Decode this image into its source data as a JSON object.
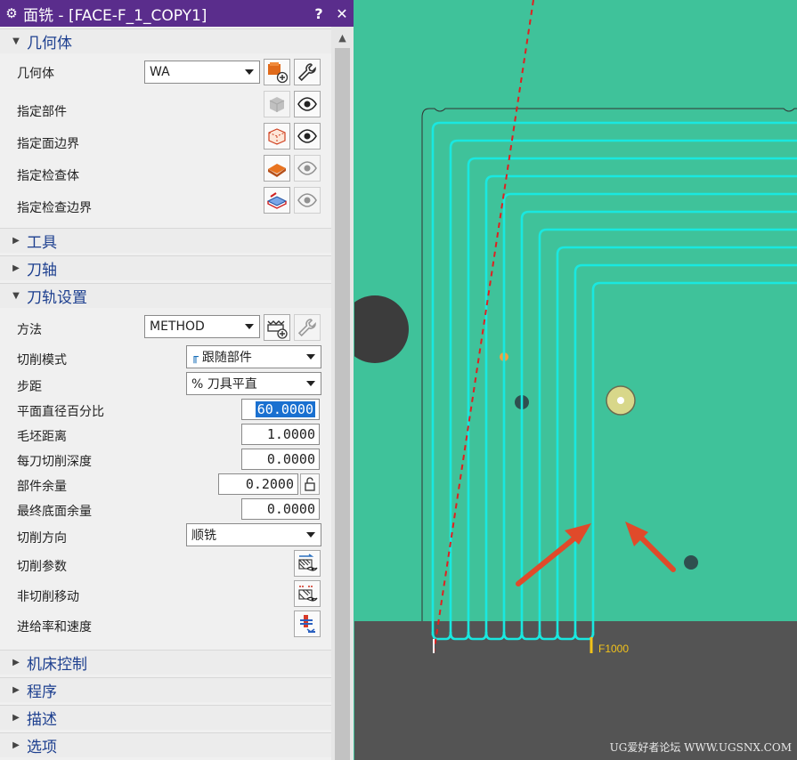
{
  "window": {
    "title": "面铣 - [FACE-F_1_COPY1]",
    "help": "?",
    "close": "✕"
  },
  "sections": {
    "geometry": {
      "label": "几何体"
    },
    "tool": {
      "label": "工具"
    },
    "axis": {
      "label": "刀轴"
    },
    "path_settings": {
      "label": "刀轨设置"
    },
    "machine_control": {
      "label": "机床控制"
    },
    "program": {
      "label": "程序"
    },
    "description": {
      "label": "描述"
    },
    "options": {
      "label": "选项"
    }
  },
  "geometry": {
    "geom_label": "几何体",
    "geom_value": "WA",
    "part_label": "指定部件",
    "face_boundary_label": "指定面边界",
    "check_body_label": "指定检查体",
    "check_boundary_label": "指定检查边界"
  },
  "path": {
    "method_label": "方法",
    "method_value": "METHOD",
    "cut_pattern_label": "切削模式",
    "cut_pattern_value": "跟随部件",
    "stepover_label": "步距",
    "stepover_value": "% 刀具平直",
    "flat_percent_label": "平面直径百分比",
    "flat_percent_value": "60.0000",
    "blank_distance_label": "毛坯距离",
    "blank_distance_value": "1.0000",
    "depth_per_cut_label": "每刀切削深度",
    "depth_per_cut_value": "0.0000",
    "part_stock_label": "部件余量",
    "part_stock_value": "0.2000",
    "final_floor_stock_label": "最终底面余量",
    "final_floor_stock_value": "0.0000",
    "cut_direction_label": "切削方向",
    "cut_direction_value": "顺铣",
    "cut_params_label": "切削参数",
    "non_cut_moves_label": "非切削移动",
    "feeds_speeds_label": "进给率和速度"
  },
  "viewport": {
    "feed_label": "F1000",
    "watermark": "UG爱好者论坛 WWW.UGSNX.COM"
  },
  "colors": {
    "title_bar": "#5a2d8c",
    "part_face": "#3fc29a",
    "toolpath": "#19e8e0",
    "arrows": "#e04a2a",
    "feed_marker": "#f3c31a",
    "machine_table": "#545454"
  }
}
